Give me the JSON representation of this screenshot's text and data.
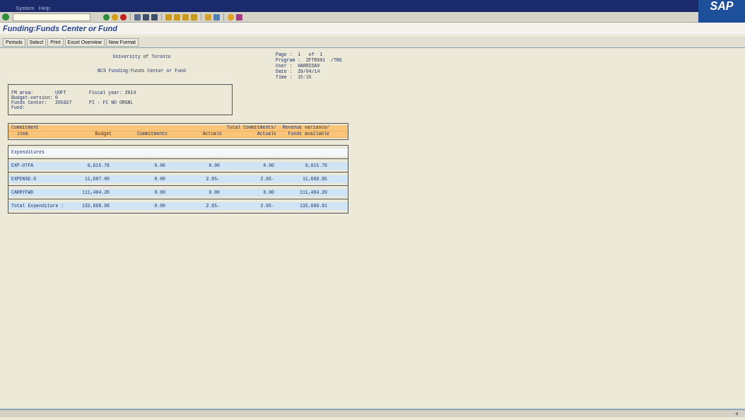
{
  "menu": [
    "System",
    "Help"
  ],
  "logo": "SAP",
  "window": {
    "title": "Funding:Funds Center or Fund"
  },
  "buttons": [
    "Periods",
    "Select",
    "Print",
    "Excel Overview",
    "New Format"
  ],
  "report": {
    "heading_lines": [
      "University of Toronto",
      "BCS Funding:Funds Center or Fund"
    ],
    "meta": [
      {
        "label": "Page :",
        "value": "1   of  1"
      },
      {
        "label": "Program :",
        "value": "ZFTR001  /TNG"
      },
      {
        "label": "User :",
        "value": "HARRIDAV"
      },
      {
        "label": "Date :",
        "value": "29/04/14"
      },
      {
        "label": "Time :",
        "value": "15:15"
      }
    ],
    "selection": [
      {
        "label": "FM area:",
        "value": "UOFT",
        "extra": "Fiscal year: 2014"
      },
      {
        "label": "Budget-version:",
        "value": "0"
      },
      {
        "label": "Funds Center:",
        "value": "205827",
        "extra": "PI - FC NO ORGNL"
      },
      {
        "label": "Fund:"
      }
    ],
    "columns": [
      {
        "top": "Commitment",
        "bottom": "item"
      },
      {
        "bottom": "Budget"
      },
      {
        "bottom": "Commitments"
      },
      {
        "bottom": "Actuals"
      },
      {
        "top": "Total Commitments/",
        "bottom": "Actuals"
      },
      {
        "top": "Revenue variance/",
        "bottom": "Funds available"
      }
    ],
    "section": "Expenditures",
    "rows": [
      [
        "EXP-UTFA",
        "9,815.76",
        "0.00",
        "0.00",
        "0.00",
        "9,815.76"
      ],
      [
        "EXPENSE-S",
        "11,667.00",
        "0.00",
        "2.65-",
        "2.65-",
        "11,669.65"
      ],
      [
        "CARRYFWD",
        "111,404.20",
        "0.00",
        "0.00",
        "0.00",
        "111,404.20"
      ],
      [
        "Total Expenditure :",
        "132,886.96",
        "0.00",
        "2.65-",
        "2.65-",
        "132,889.61"
      ]
    ]
  }
}
